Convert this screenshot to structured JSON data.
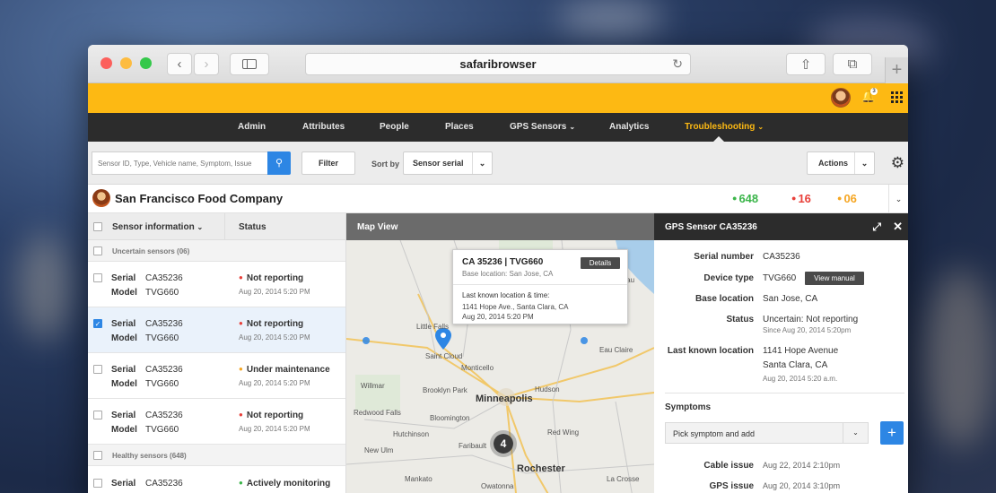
{
  "browser": {
    "url": "safaribrowser"
  },
  "nav": {
    "items": [
      {
        "label": "Admin"
      },
      {
        "label": "Attributes"
      },
      {
        "label": "People"
      },
      {
        "label": "Places"
      },
      {
        "label": "GPS Sensors"
      },
      {
        "label": "Analytics"
      },
      {
        "label": "Troubleshooting"
      }
    ]
  },
  "user": {
    "notification_count": "3"
  },
  "toolbar": {
    "search_placeholder": "Sensor ID, Type, Vehicle name, Symptom, Issue",
    "filter_label": "Filter",
    "sort_label": "Sort by",
    "sort_value": "Sensor serial",
    "actions_label": "Actions"
  },
  "company": {
    "name": "San Francisco Food Company",
    "stats": [
      {
        "value": "648",
        "color": "#3bb54a"
      },
      {
        "value": "16",
        "color": "#e8403a"
      },
      {
        "value": "06",
        "color": "#f5a623"
      }
    ]
  },
  "list": {
    "header_sensor": "Sensor information",
    "header_status": "Status",
    "groups": {
      "uncertain": "Uncertain sensors (06)",
      "healthy": "Healthy sensors (648)"
    },
    "key_serial": "Serial",
    "key_model": "Model",
    "rows": [
      {
        "serial": "CA35236",
        "model": "TVG660",
        "status": "Not reporting",
        "status_color": "#e8403a",
        "time": "Aug 20, 2014 5:20 PM",
        "checked": false
      },
      {
        "serial": "CA35236",
        "model": "TVG660",
        "status": "Not reporting",
        "status_color": "#e8403a",
        "time": "Aug 20, 2014 5:20 PM",
        "checked": true
      },
      {
        "serial": "CA35236",
        "model": "TVG660",
        "status": "Under maintenance",
        "status_color": "#f5a623",
        "time": "Aug 20, 2014 5:20 PM",
        "checked": false
      },
      {
        "serial": "CA35236",
        "model": "TVG660",
        "status": "Not reporting",
        "status_color": "#e8403a",
        "time": "Aug 20, 2014 5:20 PM",
        "checked": false
      }
    ],
    "healthy_row": {
      "serial": "CA35236",
      "status": "Actively monitoring",
      "status_color": "#3bb54a"
    }
  },
  "map": {
    "title": "Map View",
    "popup": {
      "title": "CA 35236 | TVG660",
      "base": "Base location: San Jose, CA",
      "details_label": "Details",
      "last_title": "Last known location & time:",
      "address": "1141 Hope Ave., Santa Clara, CA",
      "time": "Aug 20, 2014 5:20 PM"
    },
    "cluster_count": "4",
    "cities": [
      {
        "name": "Little Falls"
      },
      {
        "name": "Saint Cloud"
      },
      {
        "name": "Monticello"
      },
      {
        "name": "Brooklyn Park"
      },
      {
        "name": "Minneapolis"
      },
      {
        "name": "Bloomington"
      },
      {
        "name": "Faribault"
      },
      {
        "name": "Rochester"
      },
      {
        "name": "Redwood Falls"
      },
      {
        "name": "Mankato"
      },
      {
        "name": "Willmar"
      },
      {
        "name": "New Ulm"
      },
      {
        "name": "Hutchinson"
      },
      {
        "name": "Owatonna"
      },
      {
        "name": "Red Wing"
      },
      {
        "name": "Eau Claire"
      },
      {
        "name": "Wausau"
      },
      {
        "name": "La Crosse"
      },
      {
        "name": "Hudson"
      }
    ]
  },
  "detail": {
    "title": "GPS Sensor CA35236",
    "fields": {
      "serial_label": "Serial number",
      "serial": "CA35236",
      "type_label": "Device type",
      "type": "TVG660",
      "manual_label": "View manual",
      "base_label": "Base location",
      "base": "San Jose, CA",
      "status_label": "Status",
      "status": "Uncertain: Not reporting",
      "status_since": "Since Aug 20, 2014 5:20pm",
      "last_label": "Last known location",
      "last_line1": "1141 Hope Avenue",
      "last_line2": "Santa Clara, CA",
      "last_time": "Aug 20, 2014 5:20 a.m."
    },
    "symptoms_title": "Symptoms",
    "symptom_placeholder": "Pick symptom and add",
    "issues": [
      {
        "label": "Cable issue",
        "time": "Aug 22, 2014 2:10pm"
      },
      {
        "label": "GPS issue",
        "time": "Aug 20, 2014 3:10pm"
      }
    ]
  }
}
